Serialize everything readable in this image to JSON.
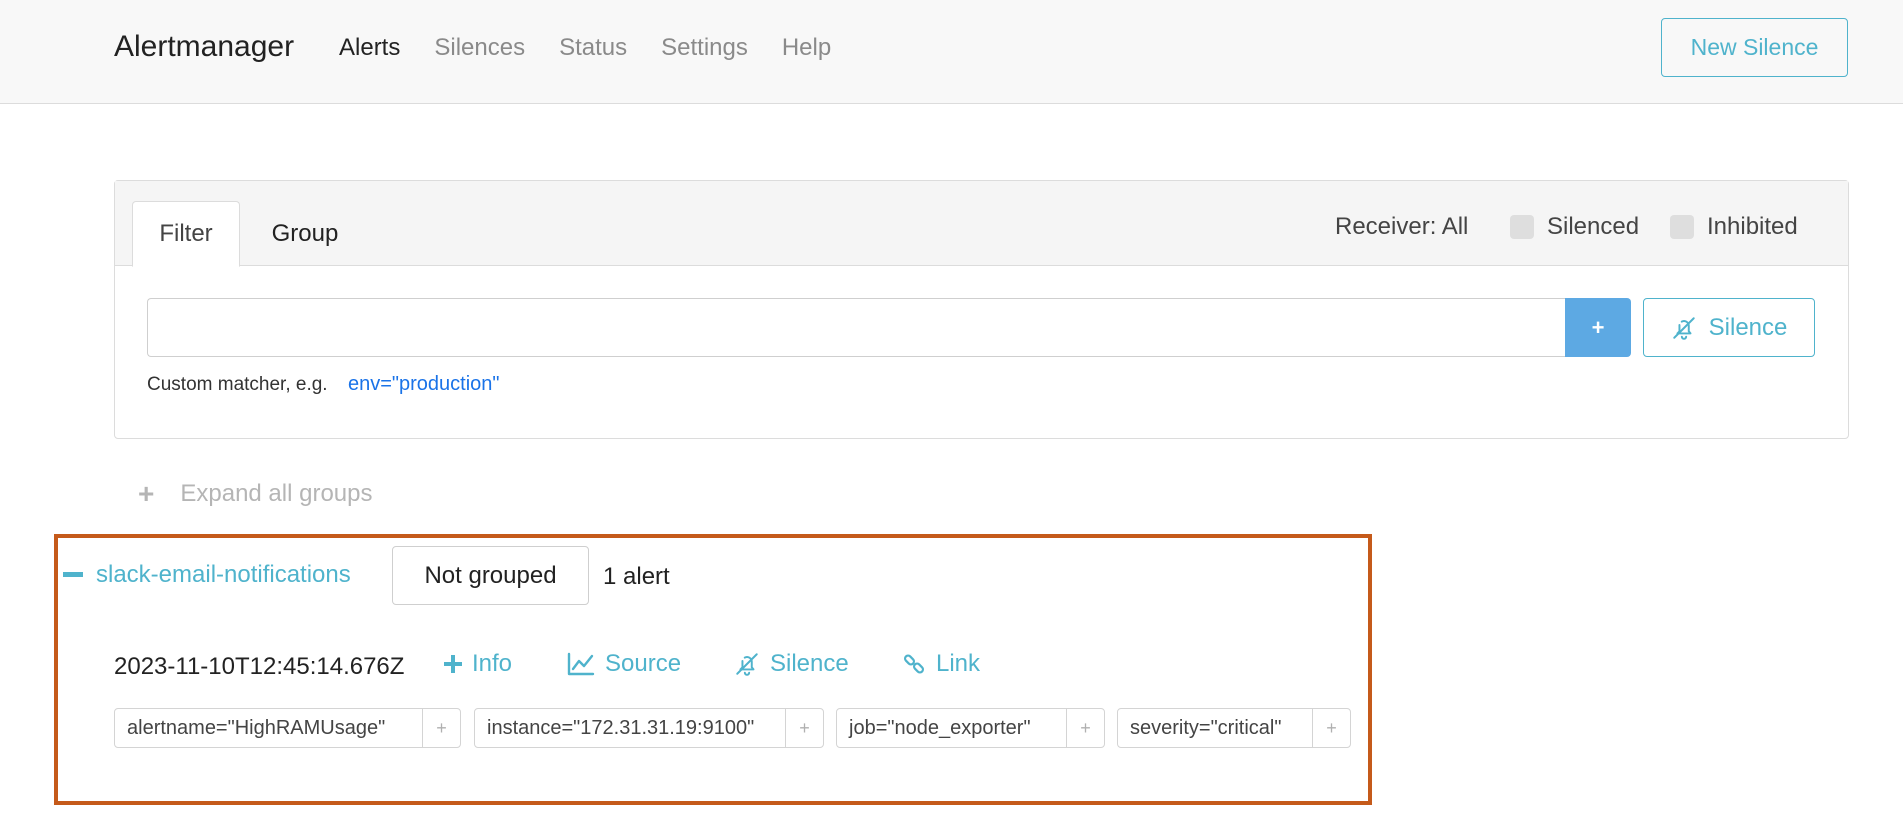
{
  "navbar": {
    "brand": "Alertmanager",
    "items": [
      {
        "label": "Alerts",
        "active": true
      },
      {
        "label": "Silences",
        "active": false
      },
      {
        "label": "Status",
        "active": false
      },
      {
        "label": "Settings",
        "active": false
      },
      {
        "label": "Help",
        "active": false
      }
    ],
    "new_silence_label": "New Silence"
  },
  "filter_card": {
    "tabs": [
      "Filter",
      "Group"
    ],
    "active_tab": "Filter",
    "receiver_label": "Receiver: All",
    "checkboxes": [
      {
        "label": "Silenced",
        "checked": false
      },
      {
        "label": "Inhibited",
        "checked": false
      }
    ],
    "matcher_value": "",
    "plus_label": "+",
    "silence_label": "Silence",
    "hint_text": "Custom matcher, e.g.",
    "hint_example": "env=\"production\""
  },
  "expand_all_label": "Expand all groups",
  "group": {
    "name": "slack-email-notifications",
    "grouping_label": "Not grouped",
    "count_label": "1 alert",
    "alert": {
      "timestamp": "2023-11-10T12:45:14.676Z",
      "actions": {
        "info": "Info",
        "source": "Source",
        "silence": "Silence",
        "link": "Link"
      },
      "labels": [
        "alertname=\"HighRAMUsage\"",
        "instance=\"172.31.31.19:9100\"",
        "job=\"node_exporter\"",
        "severity=\"critical\""
      ],
      "label_add": "+"
    }
  },
  "colors": {
    "accent": "#4fb3cc",
    "primary_button": "#5da9e3",
    "highlight_frame": "#c55a1a",
    "link": "#1a73e8"
  }
}
